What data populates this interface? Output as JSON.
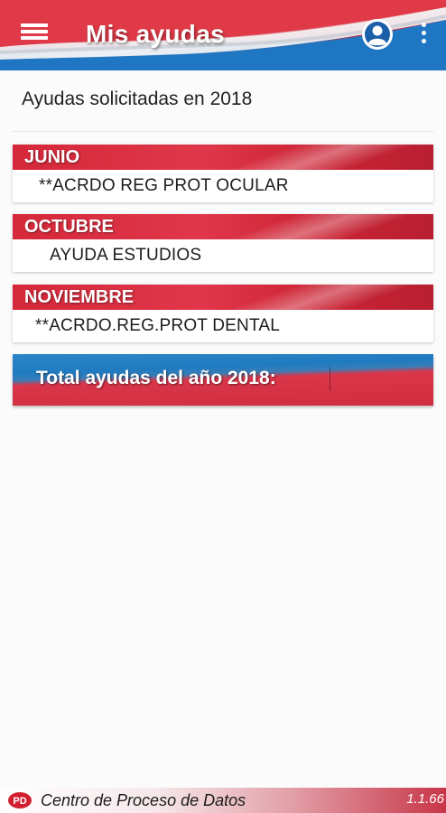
{
  "appbar": {
    "title": "Mis ayudas",
    "menu_icon": "hamburger-menu-icon",
    "account_icon": "account-circle-icon",
    "more_icon": "more-vert-icon"
  },
  "subtitle": "Ayudas solicitadas en 2018",
  "months": [
    {
      "name": "JUNIO",
      "item": "**ACRDO REG PROT OCULAR"
    },
    {
      "name": "OCTUBRE",
      "item": "AYUDA ESTUDIOS"
    },
    {
      "name": "NOVIEMBRE",
      "item": "**ACRDO.REG.PROT DENTAL"
    }
  ],
  "total": {
    "label": "Total ayudas del año 2018:"
  },
  "footer": {
    "logo_icon": "cpd-logo-icon",
    "text": "Centro de Proceso de Datos",
    "version": "1.1.66"
  },
  "colors": {
    "brand_red": "#d7303f",
    "brand_blue": "#1f75c2",
    "background": "#fbfbfb"
  }
}
